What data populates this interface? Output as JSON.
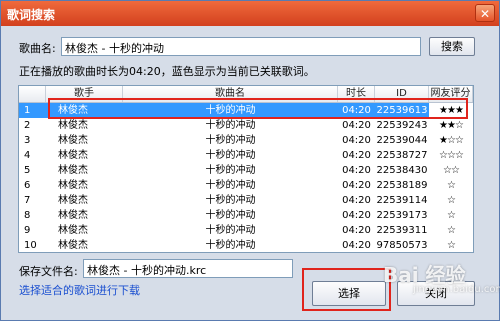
{
  "window": {
    "title": "歌词搜索",
    "close_glyph": "✕"
  },
  "search": {
    "label": "歌曲名:",
    "value": "林俊杰 - 十秒的冲动",
    "button": "搜索"
  },
  "info_text": "正在播放的歌曲时长为04:20，蓝色显示为当前已关联歌词。",
  "table": {
    "headers": [
      "",
      "歌手",
      "歌曲名",
      "时长",
      "ID",
      "网友评分"
    ],
    "rows": [
      {
        "num": "1",
        "artist": "林俊杰",
        "song": "十秒的冲动",
        "duration": "04:20",
        "id": "22539613",
        "rating": "★★★",
        "selected": true
      },
      {
        "num": "2",
        "artist": "林俊杰",
        "song": "十秒的冲动",
        "duration": "04:20",
        "id": "22539243",
        "rating": "★★☆"
      },
      {
        "num": "3",
        "artist": "林俊杰",
        "song": "十秒的冲动",
        "duration": "04:20",
        "id": "22539044",
        "rating": "★☆☆"
      },
      {
        "num": "4",
        "artist": "林俊杰",
        "song": "十秒的冲动",
        "duration": "04:20",
        "id": "22538727",
        "rating": "☆☆☆"
      },
      {
        "num": "5",
        "artist": "林俊杰",
        "song": "十秒的冲动",
        "duration": "04:20",
        "id": "22538430",
        "rating": "☆☆"
      },
      {
        "num": "6",
        "artist": "林俊杰",
        "song": "十秒的冲动",
        "duration": "04:20",
        "id": "22538189",
        "rating": "☆"
      },
      {
        "num": "7",
        "artist": "林俊杰",
        "song": "十秒的冲动",
        "duration": "04:20",
        "id": "22539114",
        "rating": "☆"
      },
      {
        "num": "8",
        "artist": "林俊杰",
        "song": "十秒的冲动",
        "duration": "04:20",
        "id": "22539173",
        "rating": "☆"
      },
      {
        "num": "9",
        "artist": "林俊杰",
        "song": "十秒的冲动",
        "duration": "04:20",
        "id": "22539311",
        "rating": "☆"
      },
      {
        "num": "10",
        "artist": "林俊杰",
        "song": "十秒的冲动",
        "duration": "04:20",
        "id": "97850573",
        "rating": "☆"
      }
    ]
  },
  "save": {
    "label": "保存文件名:",
    "value": "林俊杰 - 十秒的冲动.krc"
  },
  "link_text": "选择适合的歌词进行下载",
  "buttons": {
    "select": "选择",
    "close": "关闭"
  },
  "watermark": {
    "main": "Bai 经验",
    "sub": "jingyan.baidu.com"
  },
  "colors": {
    "title_bar": "#e04a24",
    "selection": "#3399ff",
    "highlight_box": "#e0241c"
  }
}
